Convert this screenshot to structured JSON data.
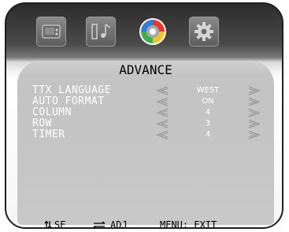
{
  "tabs": [
    {
      "icon": "picture-icon"
    },
    {
      "icon": "sound-icon"
    },
    {
      "icon": "advance-icon",
      "active": true
    },
    {
      "icon": "setup-icon"
    }
  ],
  "menu": {
    "title": "ADVANCE",
    "items": [
      {
        "label": "TTX LANGUAGE",
        "value": "WEST"
      },
      {
        "label": "AUTO FORMAT",
        "value": "ON"
      },
      {
        "label": "COLUMN",
        "value": "4"
      },
      {
        "label": "ROW",
        "value": "3"
      },
      {
        "label": "TIMER",
        "value": "4"
      }
    ]
  },
  "footer": {
    "select_label": "SE",
    "adjust_label": "ADJ",
    "menu_label": "MENU: EXIT"
  }
}
